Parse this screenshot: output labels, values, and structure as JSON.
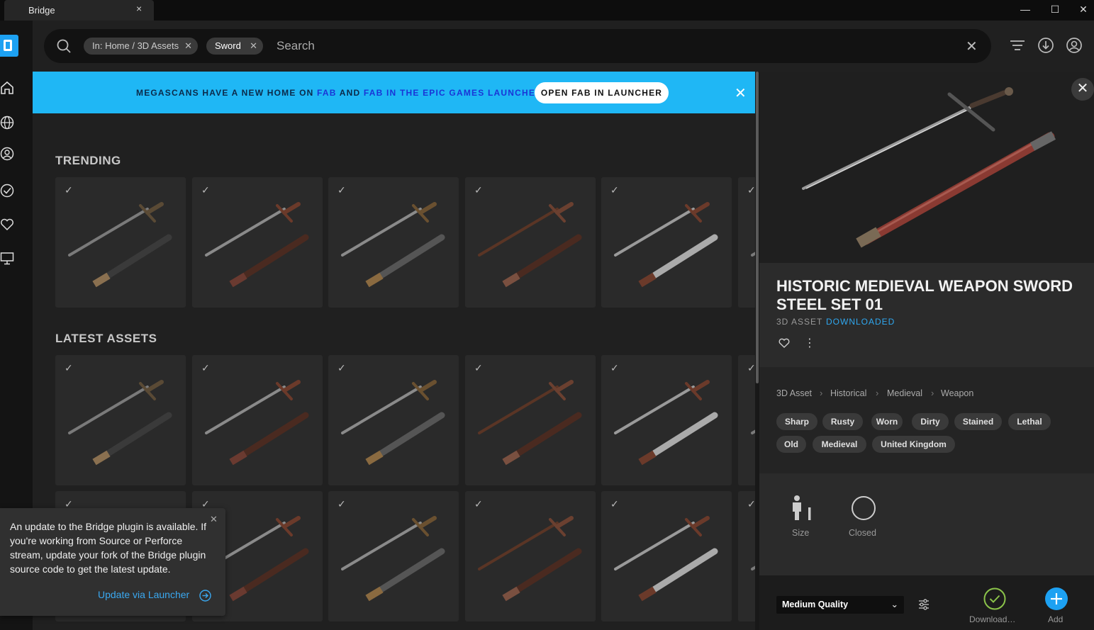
{
  "window": {
    "tab_title": "Bridge",
    "tab_close": "×",
    "minimize": "—",
    "maximize": "☐",
    "close": "✕"
  },
  "search": {
    "chips": [
      {
        "label": "In: Home / 3D Assets"
      },
      {
        "label": "Sword"
      }
    ],
    "chip_remove": "✕",
    "placeholder": "Search",
    "clear": "✕"
  },
  "sidebar": {
    "items": [
      "home-icon",
      "globe-icon",
      "user-icon",
      "check-circle-icon",
      "heart-icon",
      "monitor-icon"
    ]
  },
  "banner": {
    "text_before": "MEGASCANS HAVE A NEW HOME ON ",
    "link1": "FAB",
    "text_mid": " AND ",
    "link2": "FAB IN THE EPIC GAMES LAUNCHER",
    "button": "OPEN FAB IN LAUNCHER",
    "close": "✕"
  },
  "sections": {
    "trending": "TRENDING",
    "latest": "LATEST ASSETS"
  },
  "card_check": "✓",
  "panel": {
    "close": "✕",
    "title": "HISTORIC MEDIEVAL WEAPON SWORD STEEL SET 01",
    "type": "3D ASSET",
    "status": "DOWNLOADED",
    "more": "⋮",
    "breadcrumb": [
      "3D Asset",
      "Historical",
      "Medieval",
      "Weapon"
    ],
    "crumb_sep": "›",
    "tags": [
      "Sharp",
      "Rusty",
      "Worn",
      "Dirty",
      "Stained",
      "Lethal",
      "Old",
      "Medieval",
      "United Kingdom"
    ],
    "specs": [
      {
        "label": "Size"
      },
      {
        "label": "Closed"
      }
    ],
    "quality": "Medium Quality",
    "quality_caret": "⌄",
    "download_label": "Download…",
    "add_label": "Add"
  },
  "toast": {
    "message": "An update to the Bridge plugin is available. If you're working from Source or Perforce stream, update your fork of the Bridge plugin source code to get the latest update.",
    "action": "Update via Launcher",
    "close": "✕"
  }
}
